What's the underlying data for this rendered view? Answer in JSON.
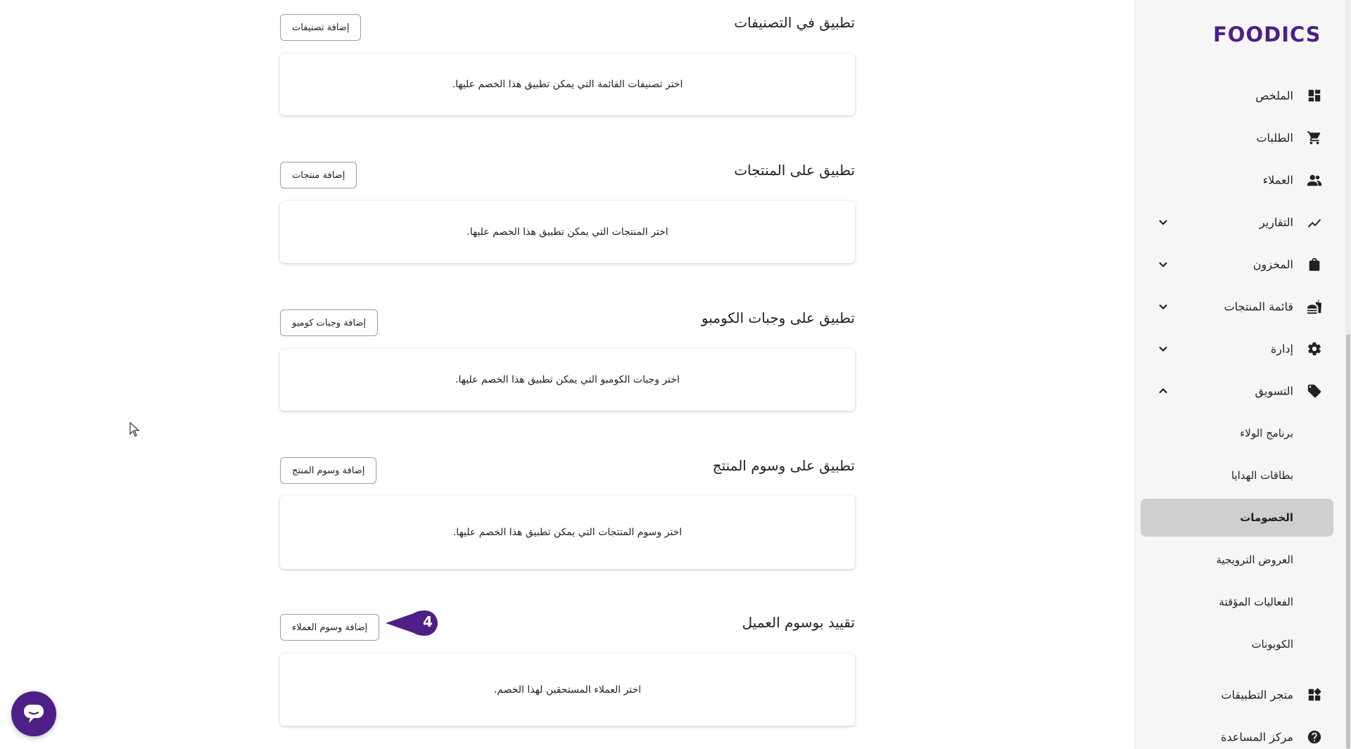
{
  "brand": {
    "logo_text": "FOODICS",
    "color": "#4e1f86"
  },
  "sidebar": {
    "items": [
      {
        "label": "الملخص",
        "icon": "dashboard-icon"
      },
      {
        "label": "الطلبات",
        "icon": "cart-icon"
      },
      {
        "label": "العملاء",
        "icon": "people-icon"
      },
      {
        "label": "التقارير",
        "icon": "trend-icon",
        "expandable": true,
        "expanded": false
      },
      {
        "label": "المخزون",
        "icon": "bag-icon",
        "expandable": true,
        "expanded": false
      },
      {
        "label": "قائمة المنتجات",
        "icon": "food-icon",
        "expandable": true,
        "expanded": false
      },
      {
        "label": "إدارة",
        "icon": "gear-icon",
        "expandable": true,
        "expanded": false
      },
      {
        "label": "التسويق",
        "icon": "tag-icon",
        "expandable": true,
        "expanded": true
      }
    ],
    "marketing_sub": [
      {
        "label": "برنامج الولاء",
        "active": false
      },
      {
        "label": "بطاقات الهدايا",
        "active": false
      },
      {
        "label": "الخصومات",
        "active": true
      },
      {
        "label": "العروض الترويجية",
        "active": false
      },
      {
        "label": "الفعاليات المؤقتة",
        "active": false
      },
      {
        "label": "الكوبونات",
        "active": false
      }
    ],
    "bottom_items": [
      {
        "label": "متجر التطبيقات",
        "icon": "apps-icon"
      },
      {
        "label": "مركز المساعدة",
        "icon": "help-icon"
      }
    ]
  },
  "sections": [
    {
      "title": "تطبيق في التصنيفات",
      "button": "إضافة تصنيفات",
      "hint": "اختر تصنيفات القائمة التي يمكن تطبيق هذا الخصم عليها."
    },
    {
      "title": "تطبيق على المنتجات",
      "button": "إضافة منتجات",
      "hint": "اختر المنتجات التي يمكن تطبيق هذا الخصم عليها."
    },
    {
      "title": "تطبيق على وجبات الكومبو",
      "button": "إضافة وجبات كومبو",
      "hint": "اختر وجبات الكومبو التي يمكن تطبيق هذا الخصم عليها."
    },
    {
      "title": "تطبيق على وسوم المنتج",
      "button": "إضافة وسوم المنتج",
      "hint": "اختر وسوم المنتجات التي يمكن تطبيق هذا الخصم عليها."
    },
    {
      "title": "تقييد بوسوم العميل",
      "button": "إضافة وسوم العملاء",
      "hint": "اختر العملاء المستحقين لهذا الخصم."
    }
  ],
  "callout": {
    "number": "4",
    "color": "#4e1f86"
  },
  "chat": {
    "icon": "chat-icon"
  }
}
